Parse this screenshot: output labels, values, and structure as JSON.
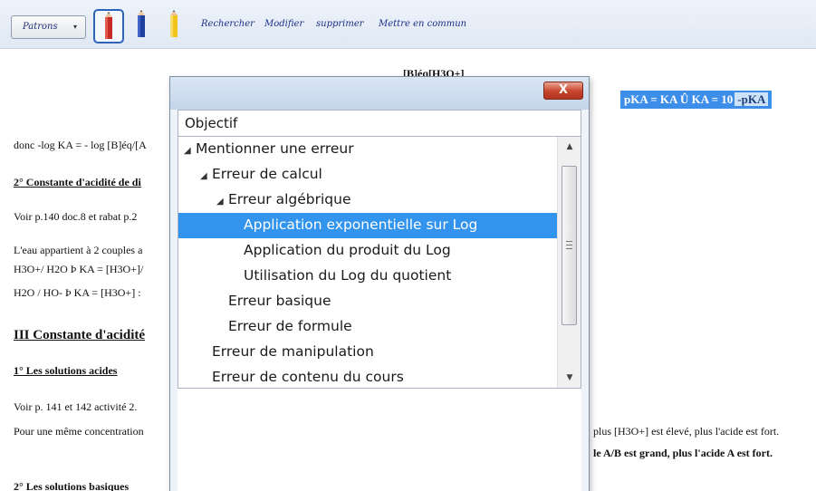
{
  "toolbar": {
    "patrons_label": "Patrons",
    "pencil_colors": [
      "#c62b24",
      "#1f3f9c",
      "#f0c419"
    ],
    "links": [
      "Rechercher",
      "Modifier",
      "supprimer",
      "Mettre en commun"
    ]
  },
  "document": {
    "formula_top": "[B]éq[H3O+]",
    "highlight_formula": "pKA = KA Û KA = 10",
    "highlight_exp": "-pKA",
    "line1": "donc -log KA = - log [B]éq/[A",
    "section2": "2° Constante d'acidité de di",
    "line_voir1": "Voir p.140 doc.8 et rabat p.2",
    "line_eau": "L'eau appartient à 2 couples a",
    "line_h3o": "H3O+/ H2O  Þ KA = [H3O+]/",
    "line_h2o": "H2O / HO-   Þ KA = [H3O+] :",
    "section3": "III Constante d'acidité",
    "sub1": "1° Les solutions acides",
    "line_voir2": "Voir p. 141 et 142 activité 2.",
    "line_pour": "Pour une même concentration",
    "right1": "plus [H3O+] est élevé, plus l'acide est fort.",
    "right2": "le A/B est grand, plus l'acide A est fort.",
    "sub2": "2° Les solutions basiques"
  },
  "dialog": {
    "close_label": "X",
    "header": "Objectif",
    "tree": [
      {
        "label": "Mentionner une erreur",
        "level": 0,
        "expanded": true
      },
      {
        "label": "Erreur de calcul",
        "level": 1,
        "expanded": true
      },
      {
        "label": "Erreur algébrique",
        "level": 2,
        "expanded": true
      },
      {
        "label": "Application exponentielle sur Log",
        "level": 3,
        "selected": true
      },
      {
        "label": "Application du produit du Log",
        "level": 3
      },
      {
        "label": "Utilisation du Log du quotient",
        "level": 3
      },
      {
        "label": "Erreur basique",
        "level": 2
      },
      {
        "label": "Erreur de formule",
        "level": 2
      },
      {
        "label": "Erreur de manipulation",
        "level": 1
      },
      {
        "label": "Erreur de contenu du cours",
        "level": 1
      }
    ]
  }
}
